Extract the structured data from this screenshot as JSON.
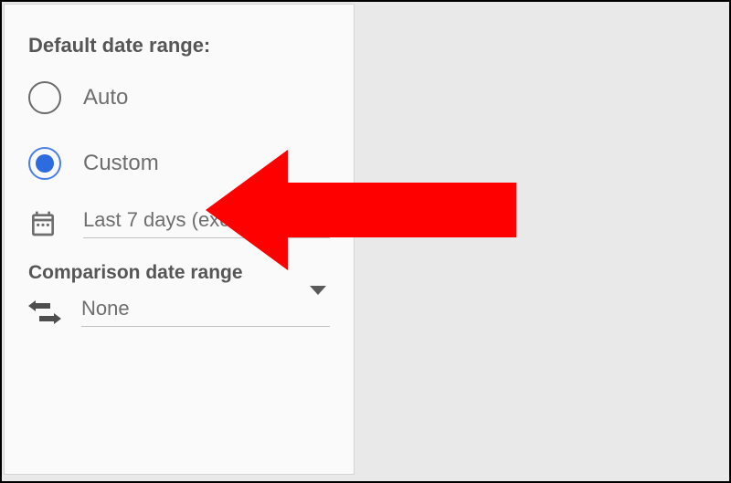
{
  "panel": {
    "defaultDateRange": {
      "title": "Default date range:",
      "options": {
        "auto": "Auto",
        "custom": "Custom"
      },
      "selectedValue": "Last 7 days (exclude …"
    },
    "comparisonDateRange": {
      "title": "Comparison date range",
      "selectedValue": "None"
    }
  }
}
